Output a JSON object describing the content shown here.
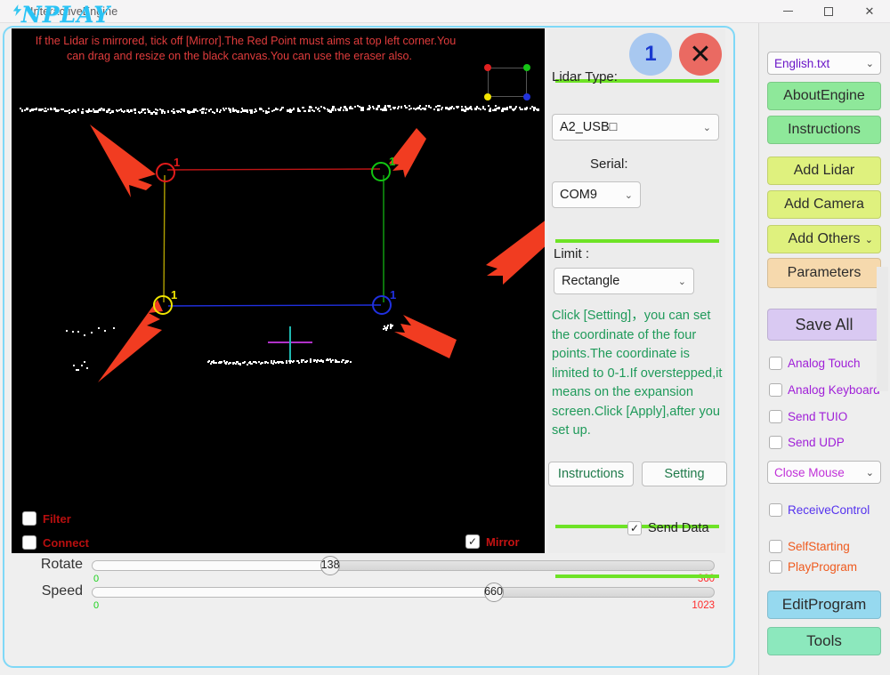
{
  "window": {
    "title": "InteractiveEngine",
    "icon": "lightning-bolt-icon",
    "minimize_label": "",
    "maximize_label": "",
    "close_label": "✕"
  },
  "canvas": {
    "note": "If the Lidar is mirrored, tick off [Mirror].The Red Point must aims at top left corner.You can drag and resize on the black canvas.You can use the eraser also.",
    "note_color": "#e03c3c",
    "legend": {
      "top_left_color": "#e02020",
      "top_right_color": "#15c415",
      "bottom_left_color": "#f2e400",
      "bottom_right_color": "#2233dd"
    },
    "corners": [
      {
        "name": "top-left",
        "label": "1",
        "color": "#e21b1b"
      },
      {
        "name": "top-right",
        "label": "1",
        "color": "#12c512"
      },
      {
        "name": "bottom-left",
        "label": "1",
        "color": "#f0e500"
      },
      {
        "name": "bottom-right",
        "label": "1",
        "color": "#2030e0"
      }
    ],
    "edges": {
      "top_color": "#c01515",
      "left_color": "#b0a000",
      "right_color": "#12a512",
      "bottom_color": "#2030e0"
    },
    "crosshair": {
      "h_color": "#b030c8",
      "v_color": "#1fb8b0"
    },
    "filter": {
      "label": "Filter",
      "checked": false
    },
    "connect": {
      "label": "Connect",
      "checked": false
    },
    "mirror": {
      "label": "Mirror",
      "checked": true,
      "mark": "✓"
    }
  },
  "sliders": {
    "rotate": {
      "label": "Rotate",
      "value": "138",
      "min": "0",
      "max": "360",
      "pct": 38.3
    },
    "speed": {
      "label": "Speed",
      "value": "660",
      "min": "0",
      "max": "1023",
      "pct": 64.5
    }
  },
  "settings": {
    "badge_number": "1",
    "badge_close": "✕",
    "lidar_type_label": "Lidar Type:",
    "lidar_type_value": "A2_USB□",
    "serial_label": "Serial:",
    "serial_value": "COM9",
    "limit_label": "Limit :",
    "limit_value": "Rectangle",
    "help_text": "Click [Setting]，you can set the coordinate of the four points.The coordinate is limited to 0-1.If overstepped,it means on the expansion screen.Click [Apply],after you set up.",
    "instructions_button": "Instructions",
    "setting_button": "Setting",
    "send_data": {
      "label": "Send Data",
      "checked": true,
      "mark": "✓"
    },
    "caret": "⌄"
  },
  "sidebar": {
    "logo": "NPLAY",
    "language": {
      "value": "English.txt",
      "caret": "⌄"
    },
    "buttons": [
      {
        "label": "AboutEngine",
        "color": "#8ee89a",
        "caret": ""
      },
      {
        "label": "Instructions",
        "color": "#8ee89a",
        "caret": ""
      },
      {
        "label": "Add Lidar",
        "color": "#dff17e",
        "caret": ""
      },
      {
        "label": "Add Camera",
        "color": "#dff17e",
        "caret": ""
      },
      {
        "label": "Add Others",
        "color": "#dff17e",
        "caret": "⌄"
      },
      {
        "label": "Parameters",
        "color": "#f6d9ad",
        "caret": ""
      },
      {
        "label": "Save All",
        "color": "#d9c9f2",
        "caret": ""
      }
    ],
    "checkboxes": [
      {
        "label": "Analog Touch",
        "checked": false,
        "color": "#a020d8"
      },
      {
        "label": "Analog Keyboard",
        "checked": false,
        "color": "#a020d8"
      },
      {
        "label": "Send TUIO",
        "checked": false,
        "color": "#a020d8"
      },
      {
        "label": "Send UDP",
        "checked": false,
        "color": "#a020d8"
      }
    ],
    "mouse_mode": {
      "value": "Close Mouse",
      "caret": "⌄",
      "color": "#c030d8"
    },
    "checkboxes2": [
      {
        "label": "ReceiveControl",
        "checked": false,
        "color": "#5533ee"
      },
      {
        "label": "SelfStarting",
        "checked": false,
        "color": "#ef5a1e"
      },
      {
        "label": "PlayProgram",
        "checked": false,
        "color": "#ef5a1e"
      }
    ],
    "bottom_buttons": [
      {
        "label": "EditProgram",
        "color": "#96d9ef"
      },
      {
        "label": "Tools",
        "color": "#8ce8bd"
      }
    ]
  }
}
